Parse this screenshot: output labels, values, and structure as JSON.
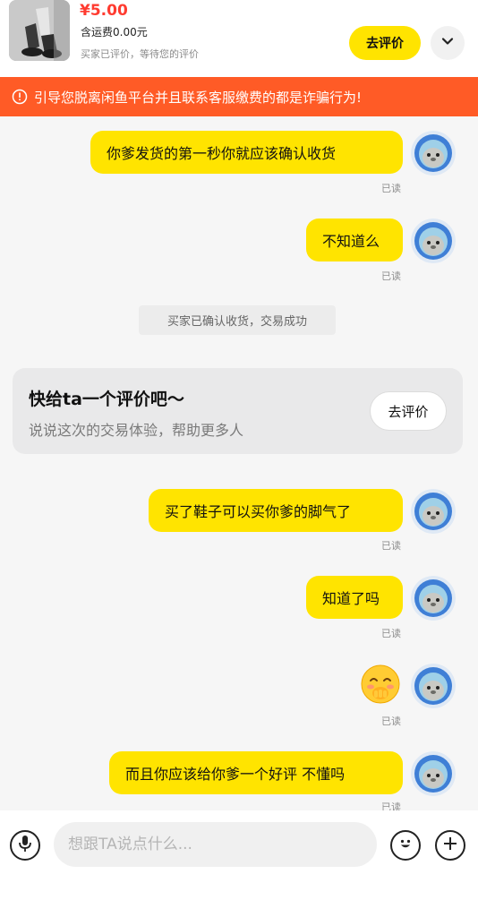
{
  "product": {
    "price": "¥5.00",
    "shipping": "含运费0.00元",
    "status": "买家已评价，等待您的评价",
    "review_button": "去评价",
    "expand_icon": "chevron-down-icon"
  },
  "warning": {
    "icon": "alert-circle-icon",
    "text": "引导您脱离闲鱼平台并且联系客服缴费的都是诈骗行为!"
  },
  "messages": [
    {
      "text": "你爹发货的第一秒你就应该确认收货",
      "read": "已读"
    },
    {
      "text": "不知道么",
      "read": "已读"
    },
    {
      "text": "买了鞋子可以买你爹的脚气了",
      "read": "已读"
    },
    {
      "text": "知道了吗",
      "read": "已读"
    },
    {
      "emoji": "blushing-face-emoji",
      "read": "已读"
    },
    {
      "text": "而且你应该给你爹一个好评 不懂吗",
      "read": "已读"
    }
  ],
  "system_notice": "买家已确认收货，交易成功",
  "review_card": {
    "title": "快给ta一个评价吧～",
    "subtitle": "说说这次的交易体验，帮助更多人",
    "button": "去评价"
  },
  "input_bar": {
    "placeholder": "想跟TA说点什么...",
    "value": "",
    "voice_icon": "microphone-icon",
    "emoji_icon": "smile-icon",
    "plus_icon": "plus-icon"
  },
  "colors": {
    "accent": "#ffe400",
    "warning": "#ff5b26",
    "price": "#ff3b30",
    "background": "#f6f6f6"
  }
}
